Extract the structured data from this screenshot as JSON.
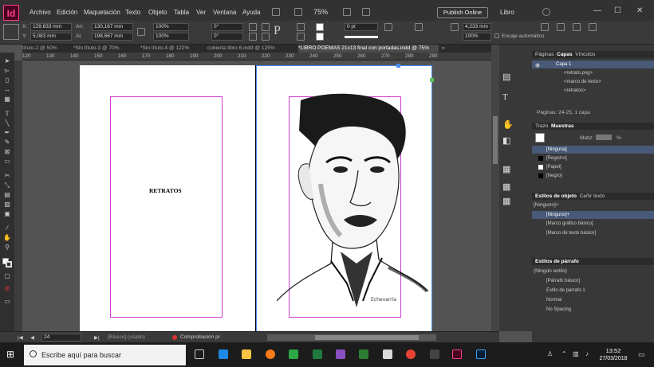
{
  "menubar": {
    "logo": "Id",
    "items": [
      "Archivo",
      "Edición",
      "Maquetación",
      "Texto",
      "Objeto",
      "Tabla",
      "Ver",
      "Ventana",
      "Ayuda"
    ],
    "zoom": "75%",
    "publish": "Publish Online",
    "workspace": "Libro"
  },
  "control": {
    "x_label": "X:",
    "x_value": "129,833 mm",
    "y_label": "Y:",
    "y_value": "5,083 mm",
    "w_label": "An:",
    "w_value": "130,167 mm",
    "h_label": "Al:",
    "h_value": "198,667 mm",
    "scale_x": "100%",
    "scale_y": "100%",
    "angle": "0°",
    "shear": "0°",
    "stroke_weight": "0 pt",
    "frame_w": "4,233 mm",
    "frame_h": "100%",
    "autofit": "Encaje automático"
  },
  "tabs": [
    {
      "label": "título-2 @ 50%"
    },
    {
      "label": "*Sin título-3 @ 70%"
    },
    {
      "label": "*Sin título-4 @ 122%"
    },
    {
      "label": "cubierta libro 6.indd @ 125%"
    },
    {
      "label": "*LIBRO POEMAS 21x13 final con portadas.indd @ 75%",
      "active": true
    }
  ],
  "ruler": [
    "120",
    "130",
    "140",
    "150",
    "160",
    "170",
    "180",
    "190",
    "200",
    "210",
    "220",
    "230",
    "240",
    "250",
    "260",
    "270",
    "280",
    "290"
  ],
  "page_text": "RETRATOS",
  "signature": "Echevarría",
  "status": {
    "page": "24",
    "page_style": "[Básico] (usado)",
    "preflight": "Comprobación pr"
  },
  "right_icons": {
    "pages_label": "Páginas",
    "layers_label": "Capas",
    "stroke_label": "Trazo",
    "swatches_label": "Muestras"
  },
  "panels": {
    "layers": {
      "tabs": [
        "Páginas",
        "Capas",
        "Vínculos"
      ],
      "layer": "Capa 1",
      "items": [
        "<retrato.png>",
        "<marco de texto>",
        "<retratos>"
      ],
      "footer": "Páginas: 24-25, 1 capa"
    },
    "swatches": {
      "tabs": [
        "Trazo",
        "Muestras"
      ],
      "tint_label": "Matiz:",
      "tint_unit": "%",
      "items": [
        "[Ninguna]",
        "[Registro]",
        "[Papel]",
        "[Negro]"
      ]
    },
    "object_styles": {
      "tabs": [
        "Estilos de objeto",
        "Ceñir texto"
      ],
      "current": "[Ninguno]+",
      "items": [
        "[Ninguno]+",
        "[Marco gráfico básico]",
        "[Marco de texto básico]"
      ]
    },
    "para_styles": {
      "title": "Estilos de párrafo",
      "current": "(Ningún estilo)",
      "items": [
        "[Párrafo básico]",
        "Estilo de párrafo 1",
        "Normal",
        "No Spacing"
      ]
    }
  },
  "taskbar": {
    "search_placeholder": "Escribe aquí para buscar",
    "time": "13:52",
    "date": "27/03/2018"
  }
}
